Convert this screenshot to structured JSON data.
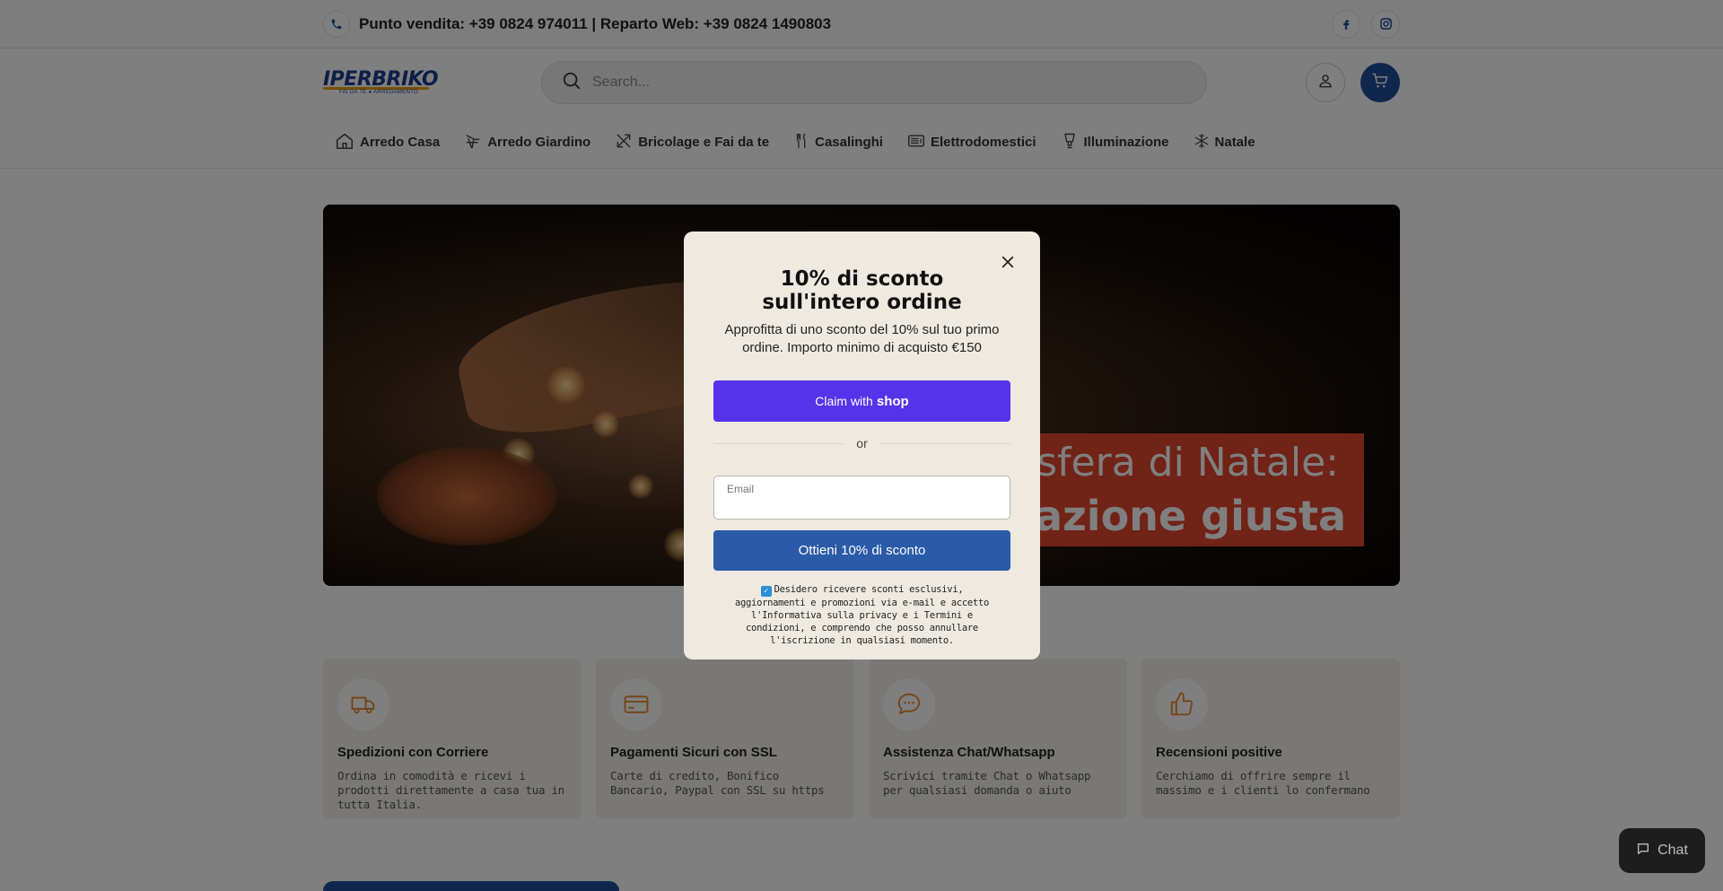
{
  "topbar": {
    "contact_text": "Punto vendita: +39 0824 974011 | Reparto Web: +39 0824 1490803",
    "social": [
      "facebook-icon",
      "instagram-icon"
    ]
  },
  "header": {
    "logo_text": "IPERBRIKO",
    "logo_tagline": "FAI DA TE ● ARREDAMENTO",
    "search_placeholder": "Search..."
  },
  "nav": {
    "items": [
      {
        "label": "Arredo Casa",
        "icon": "house-icon"
      },
      {
        "label": "Arredo Giardino",
        "icon": "garden-chair-icon"
      },
      {
        "label": "Bricolage e Fai da te",
        "icon": "tools-icon"
      },
      {
        "label": "Casalinghi",
        "icon": "cutlery-icon"
      },
      {
        "label": "Elettrodomestici",
        "icon": "microwave-icon"
      },
      {
        "label": "Illuminazione",
        "icon": "lamp-icon"
      },
      {
        "label": "Natale",
        "icon": "snowflake-icon"
      }
    ]
  },
  "hero": {
    "line1": "osfera di Natale:",
    "line2": "minazione giusta"
  },
  "features": [
    {
      "title": "Spedizioni con Corriere",
      "text": "Ordina in comodità e ricevi i prodotti direttamente a casa tua in tutta Italia.",
      "icon": "truck-icon"
    },
    {
      "title": "Pagamenti Sicuri con SSL",
      "text": "Carte di credito, Bonifico Bancario, Paypal con SSL su https",
      "icon": "credit-card-icon"
    },
    {
      "title": "Assistenza Chat/Whatsapp",
      "text": "Scrivici tramite Chat o Whatsapp per qualsiasi domanda o aiuto",
      "icon": "chat-bubble-icon"
    },
    {
      "title": "Recensioni positive",
      "text": "Cerchiamo di offrire sempre il massimo e i clienti lo confermano",
      "icon": "thumbs-up-icon"
    }
  ],
  "modal": {
    "title": "10% di sconto sull'intero ordine",
    "subtitle": "Approfitta di uno sconto del 10% sul tuo primo ordine. Importo minimo di acquisto €150",
    "shop_button_prefix": "Claim with",
    "shop_button_brand": "shop",
    "or_text": "or",
    "email_label": "Email",
    "submit_label": "Ottieni 10% di sconto",
    "consent_text": "Desidero ricevere sconti esclusivi, aggiornamenti e promozioni via e-mail e accetto l'Informativa sulla privacy e i Termini e condizioni, e comprendo che posso annullare l'iscrizione in qualsiasi momento.",
    "consent_checked": true
  },
  "chat": {
    "label": "Chat"
  },
  "colors": {
    "brand_blue": "#1f4e9b",
    "shop_purple": "#5433eb",
    "accent_orange": "#e8892b",
    "hero_red": "#e1472c"
  }
}
